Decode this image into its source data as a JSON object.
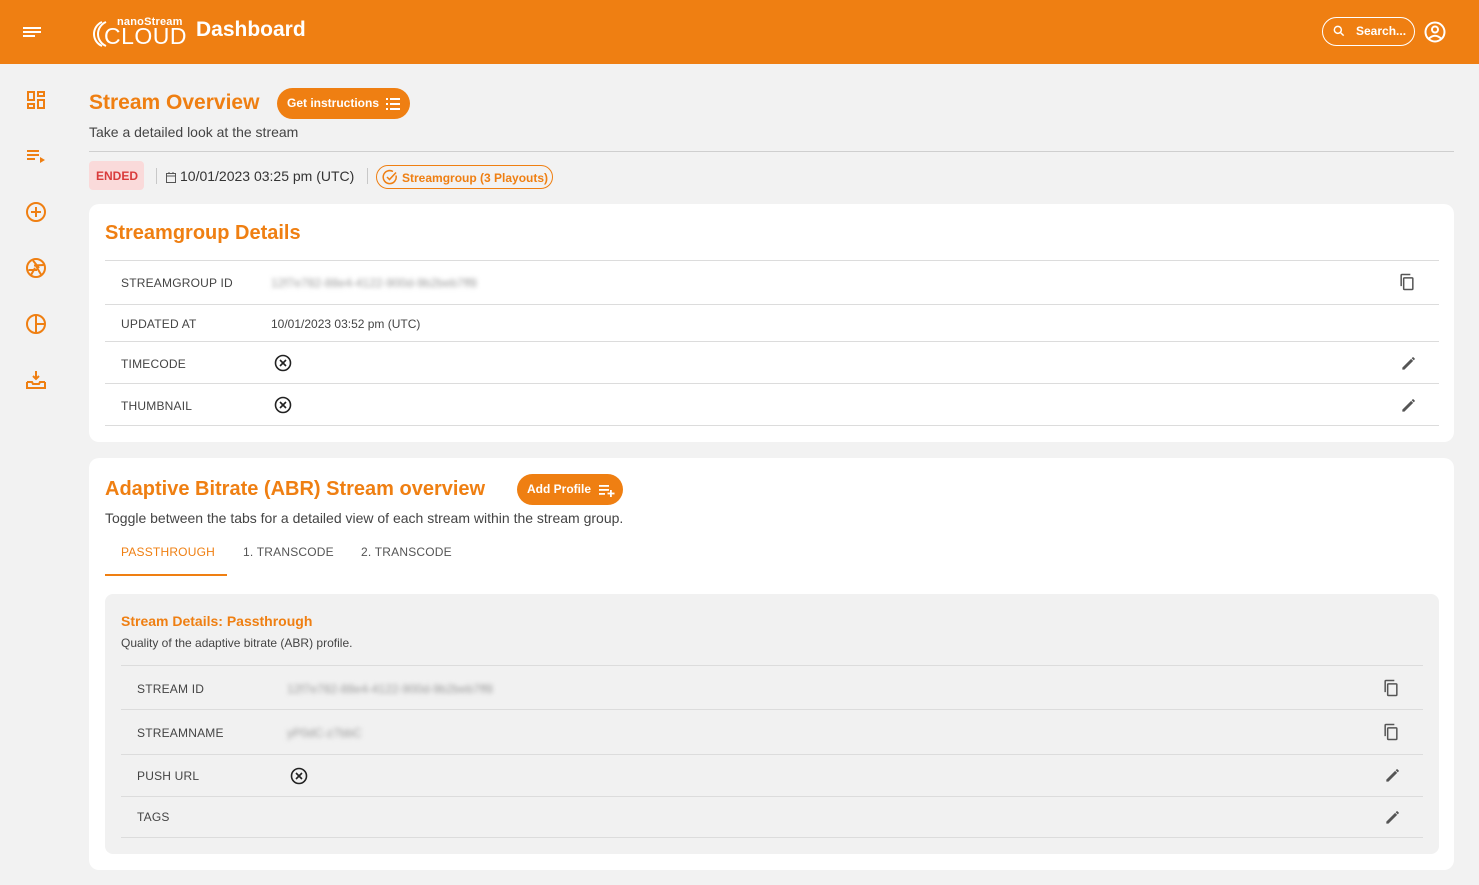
{
  "header": {
    "logo_small": "nanoStream",
    "logo_big": "CLOUD",
    "title": "Dashboard",
    "search_label": "Search...",
    "brand_color": "#ef7f12"
  },
  "sidebar": {
    "icons": [
      "dashboard-icon",
      "playlist-play-icon",
      "add-circle-icon",
      "shutter-icon",
      "pie-chart-icon",
      "inbox-download-icon"
    ]
  },
  "overview": {
    "title": "Stream Overview",
    "instructions_label": "Get instructions",
    "subtitle": "Take a detailed look at the stream",
    "status": "ENDED",
    "date": "10/01/2023 03:25 pm (UTC)",
    "streamgroup_chip": "Streamgroup (3 Playouts)"
  },
  "streamgroup": {
    "title": "Streamgroup Details",
    "rows": {
      "id_label": "STREAMGROUP ID",
      "id_value": "12f7e782-88e4-4122-900d-9b2beb7ff8",
      "updated_label": "UPDATED AT",
      "updated_value": "10/01/2023 03:52 pm (UTC)",
      "timecode_label": "TIMECODE",
      "thumbnail_label": "THUMBNAIL"
    }
  },
  "abr": {
    "title": "Adaptive Bitrate (ABR) Stream overview",
    "add_profile_label": "Add Profile",
    "subtitle": "Toggle between the tabs for a detailed view of each stream within the stream group.",
    "tabs": [
      "PASSTHROUGH",
      "1. TRANSCODE",
      "2. TRANSCODE"
    ],
    "active_tab": "PASSTHROUGH",
    "details": {
      "title": "Stream Details: Passthrough",
      "subtitle": "Quality of the adaptive bitrate (ABR) profile.",
      "stream_id_label": "STREAM ID",
      "stream_id_value": "12f7e782-88e4-4122-900d-9b2beb7ff8",
      "streamname_label": "STREAMNAME",
      "streamname_value": "yP0dC-z7bbC",
      "push_url_label": "PUSH URL",
      "tags_label": "TAGS"
    }
  }
}
